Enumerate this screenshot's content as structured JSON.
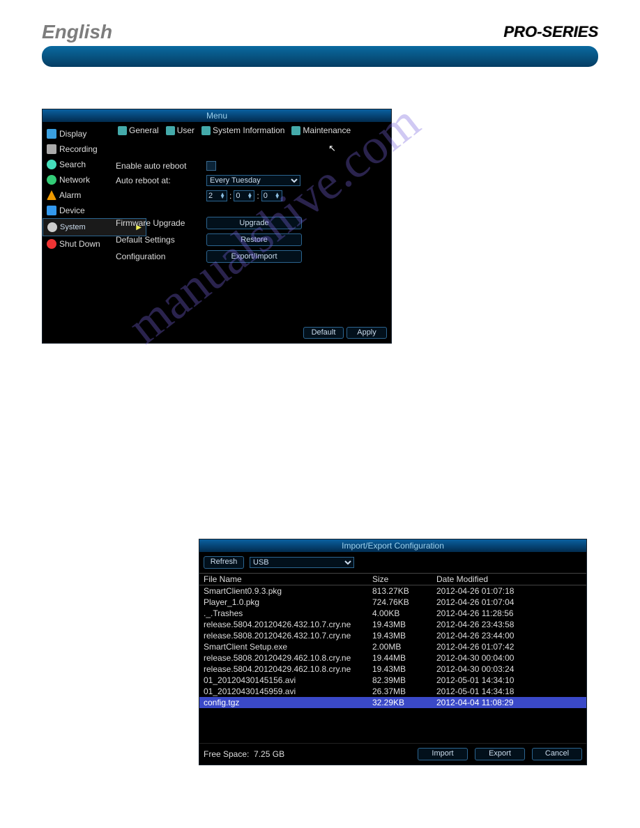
{
  "header": {
    "language": "English",
    "series": "PRO-SERIES"
  },
  "watermark": "manualshive.com",
  "win1": {
    "title": "Menu",
    "sidebar": [
      "Display",
      "Recording",
      "Search",
      "Network",
      "Alarm",
      "Device",
      "System",
      "Shut Down"
    ],
    "tabs": [
      "General",
      "User",
      "System Information",
      "Maintenance"
    ],
    "fields": {
      "enableAutoReboot": "Enable auto reboot",
      "autoRebootAt": "Auto reboot at:",
      "firmwareUpgrade": "Firmware Upgrade",
      "defaultSettings": "Default Settings",
      "configuration": "Configuration"
    },
    "values": {
      "day": "Every Tuesday",
      "hour": "2",
      "minute": "0",
      "second": "0"
    },
    "buttons": {
      "upgrade": "Upgrade",
      "restore": "Restore",
      "exportImport": "Export/Import",
      "default": "Default",
      "apply": "Apply"
    }
  },
  "win2": {
    "title": "Import/Export Configuration",
    "refresh": "Refresh",
    "device": "USB",
    "columns": [
      "File Name",
      "Size",
      "Date Modified"
    ],
    "files": [
      {
        "name": "SmartClient0.9.3.pkg",
        "size": "813.27KB",
        "date": "2012-04-26 01:07:18",
        "sel": false
      },
      {
        "name": "Player_1.0.pkg",
        "size": "724.76KB",
        "date": "2012-04-26 01:07:04",
        "sel": false
      },
      {
        "name": "._.Trashes",
        "size": "4.00KB",
        "date": "2012-04-26 11:28:56",
        "sel": false
      },
      {
        "name": "release.5804.20120426.432.10.7.cry.ne",
        "size": "19.43MB",
        "date": "2012-04-26 23:43:58",
        "sel": false
      },
      {
        "name": "release.5808.20120426.432.10.7.cry.ne",
        "size": "19.43MB",
        "date": "2012-04-26 23:44:00",
        "sel": false
      },
      {
        "name": "SmartClient Setup.exe",
        "size": "2.00MB",
        "date": "2012-04-26 01:07:42",
        "sel": false
      },
      {
        "name": "release.5808.20120429.462.10.8.cry.ne",
        "size": "19.44MB",
        "date": "2012-04-30 00:04:00",
        "sel": false
      },
      {
        "name": "release.5804.20120429.462.10.8.cry.ne",
        "size": "19.43MB",
        "date": "2012-04-30 00:03:24",
        "sel": false
      },
      {
        "name": "01_20120430145156.avi",
        "size": "82.39MB",
        "date": "2012-05-01 14:34:10",
        "sel": false
      },
      {
        "name": "01_20120430145959.avi",
        "size": "26.37MB",
        "date": "2012-05-01 14:34:18",
        "sel": false
      },
      {
        "name": "config.tgz",
        "size": "32.29KB",
        "date": "2012-04-04 11:08:29",
        "sel": true
      }
    ],
    "freeSpaceLabel": "Free Space:",
    "freeSpaceValue": "7.25 GB",
    "buttons": {
      "import": "Import",
      "export": "Export",
      "cancel": "Cancel"
    }
  }
}
